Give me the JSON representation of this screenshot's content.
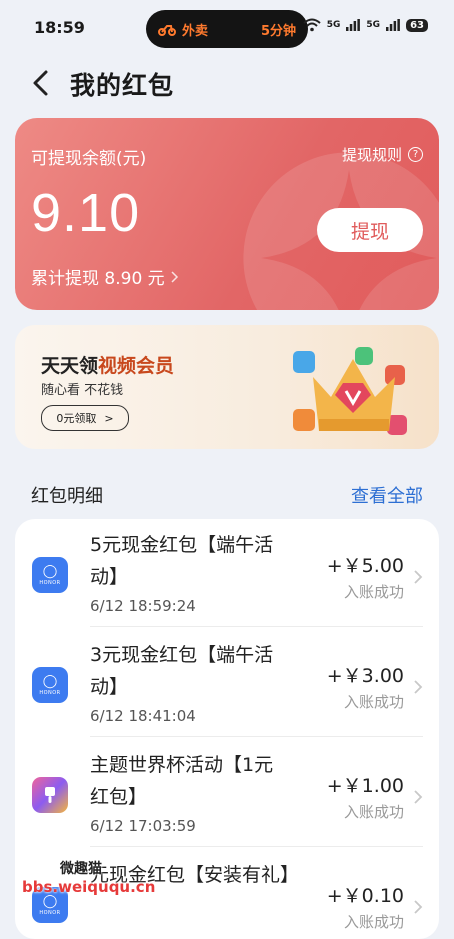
{
  "status_bar": {
    "time": "18:59",
    "island_app": "外卖",
    "island_eta": "5分钟",
    "signal1": "5G",
    "signal2": "5G",
    "battery": "63"
  },
  "header": {
    "title": "我的红包"
  },
  "balance": {
    "label": "可提现余额(元)",
    "rules": "提现规则",
    "amount": "9.10",
    "withdraw": "提现",
    "total": "累计提现 8.90 元",
    "color": "#e26666"
  },
  "promo": {
    "title_plain": "天天领",
    "title_highlight": "视频会员",
    "subtitle": "随心看 不花钱",
    "button": "0元领取",
    "button_arrow": ">"
  },
  "section": {
    "title": "红包明细",
    "link": "查看全部"
  },
  "records": [
    {
      "name": "5元现金红包【端午活动】",
      "date": "6/12 18:59:24",
      "value": "+￥5.00",
      "status": "入账成功",
      "icon": "honor-bag-icon",
      "brand": "HONOR"
    },
    {
      "name": "3元现金红包【端午活动】",
      "date": "6/12 18:41:04",
      "value": "+￥3.00",
      "status": "入账成功",
      "icon": "honor-bag-icon",
      "brand": "HONOR"
    },
    {
      "name": "主题世界杯活动【1元红包】",
      "date": "6/12 17:03:59",
      "value": "+￥1.00",
      "status": "入账成功",
      "icon": "theme-brush-icon",
      "brand": ""
    },
    {
      "name": "元现金红包【安装有礼】",
      "date": "",
      "value": "+￥0.10",
      "status": "入账成功",
      "icon": "honor-bag-icon",
      "brand": "HONOR"
    }
  ],
  "watermark": {
    "line1": "微趣猫",
    "line2": "bbs.weiququ.cn"
  }
}
